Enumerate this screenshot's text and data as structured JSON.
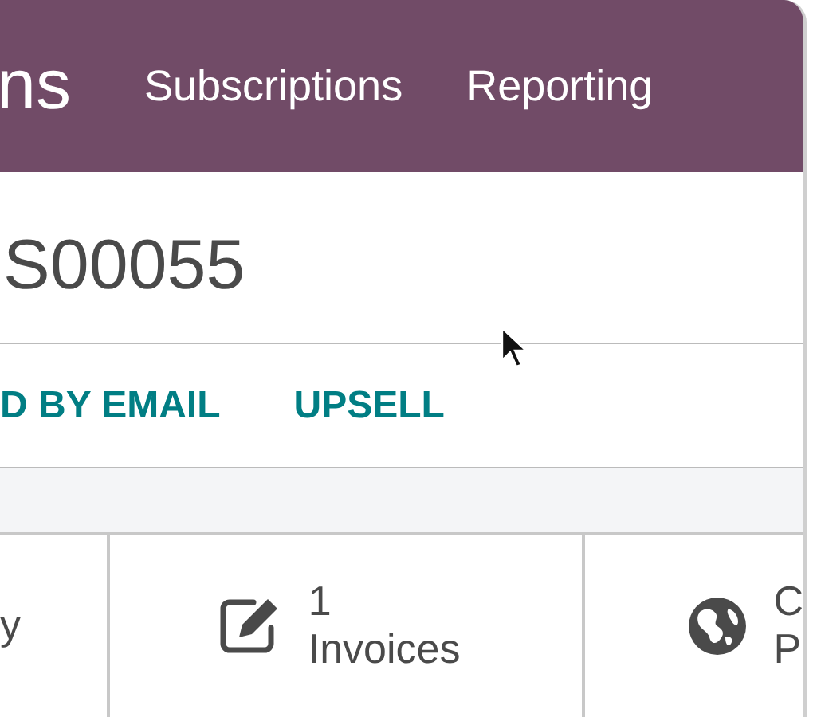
{
  "navbar": {
    "app_name": "ns",
    "menu": [
      {
        "label": "Subscriptions"
      },
      {
        "label": "Reporting"
      }
    ]
  },
  "record": {
    "title": "S00055"
  },
  "actions": [
    {
      "label": "D BY EMAIL"
    },
    {
      "label": "UPSELL"
    }
  ],
  "stat_buttons": [
    {
      "kind": "text",
      "lines": [
        "y"
      ]
    },
    {
      "kind": "invoices",
      "lines": [
        "1",
        "Invoices"
      ]
    },
    {
      "kind": "globe",
      "lines": [
        "C",
        "P"
      ]
    }
  ]
}
